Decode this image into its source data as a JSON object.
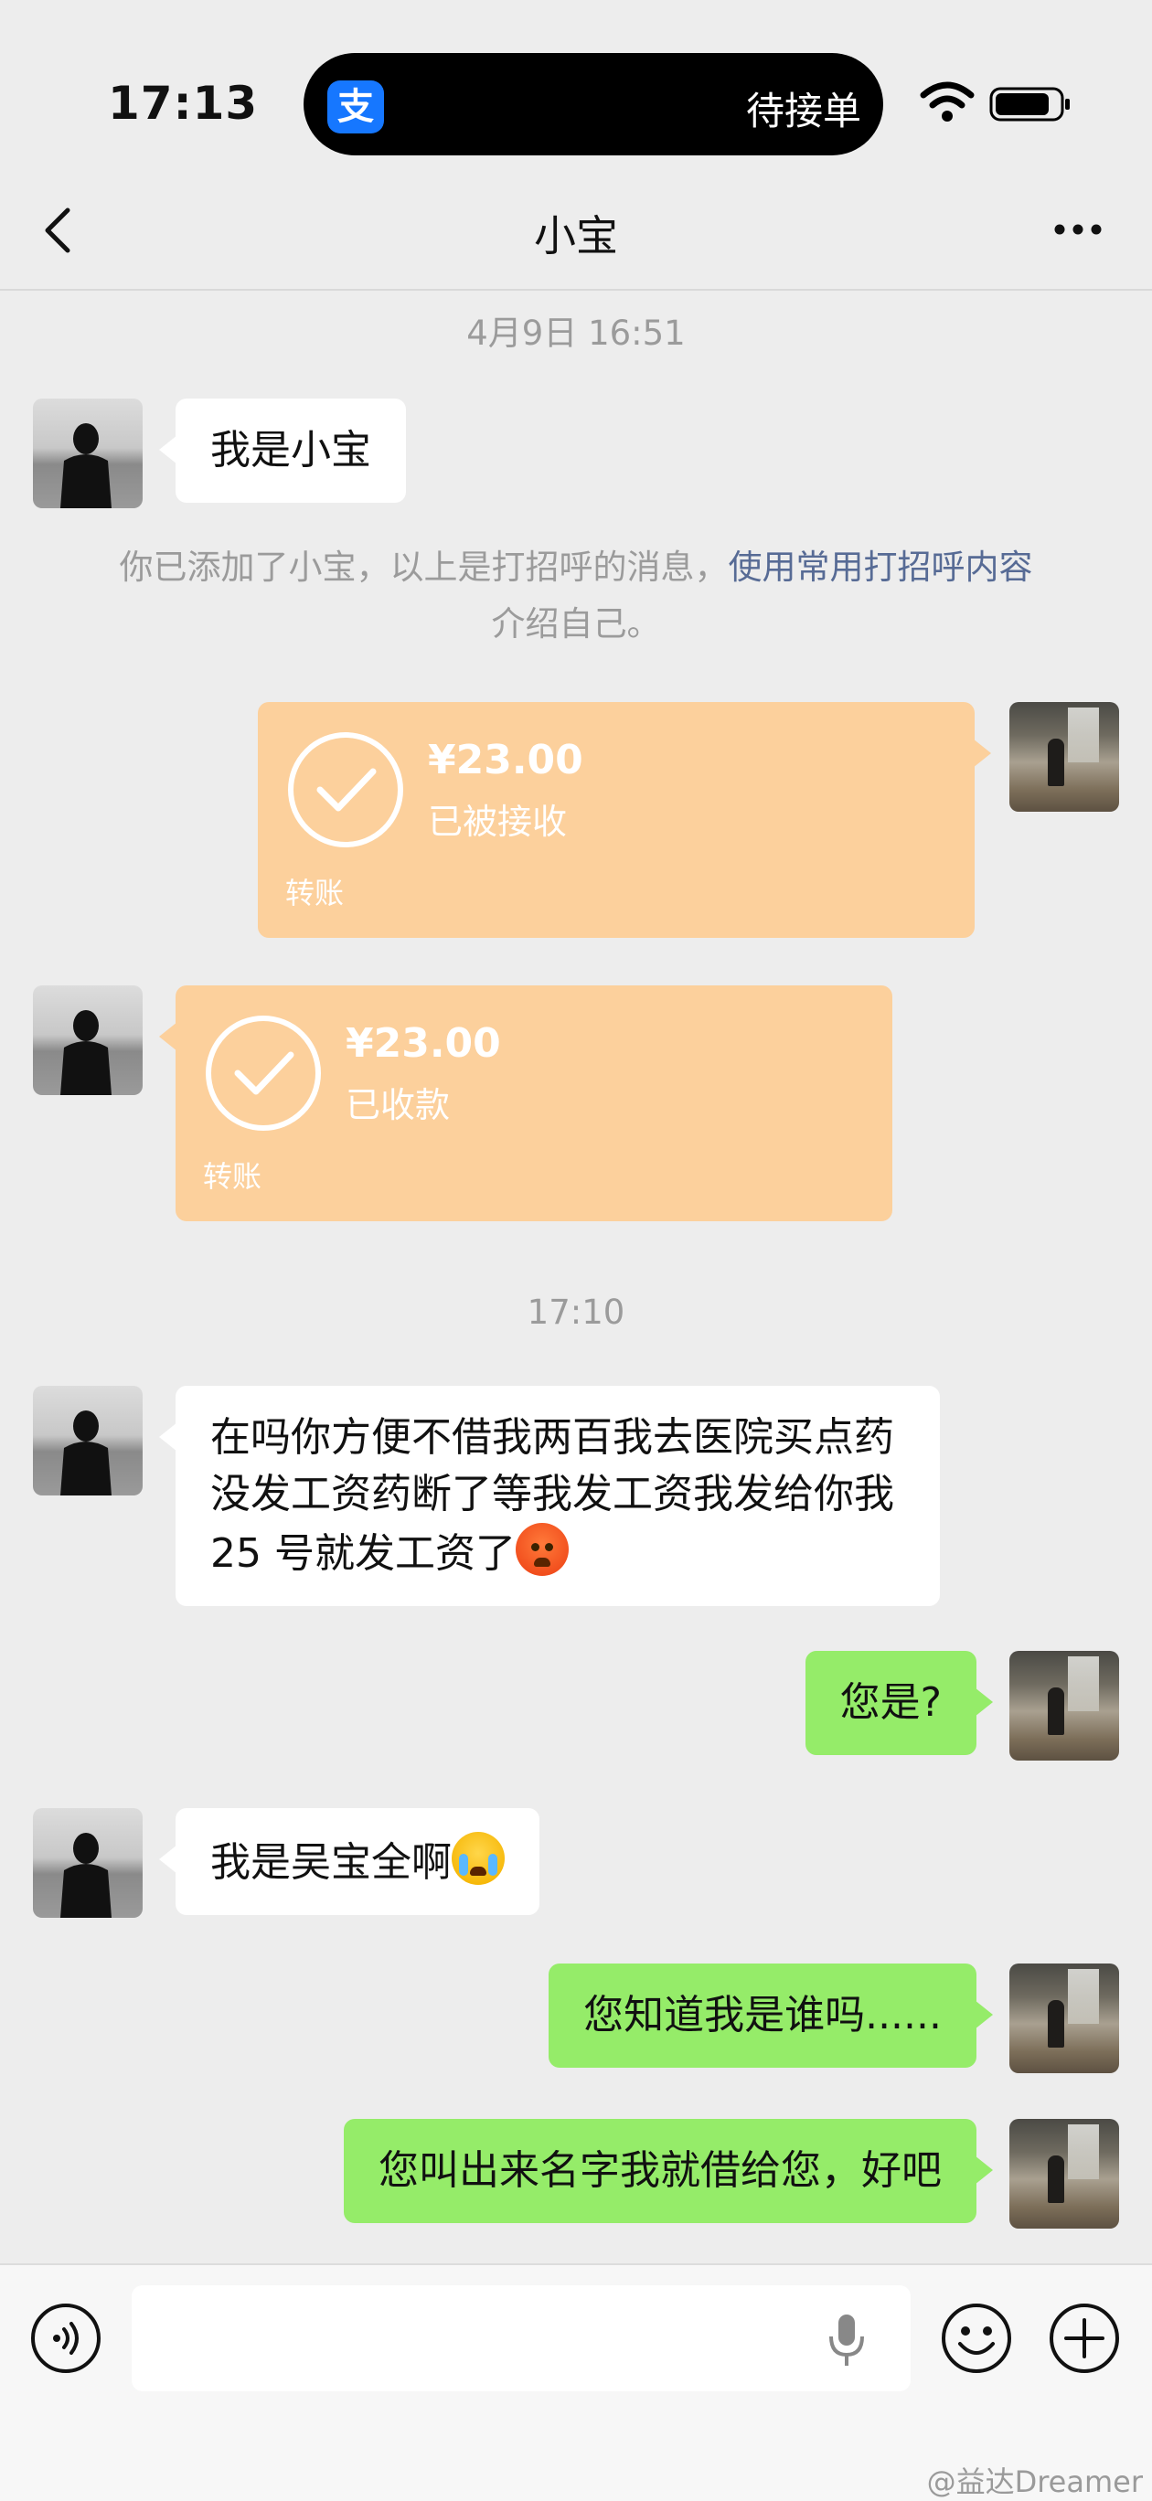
{
  "status_bar": {
    "time": "17:13",
    "island_app_icon": "支",
    "island_text": "待接单",
    "icons": [
      "wifi-icon",
      "battery-icon"
    ]
  },
  "nav": {
    "title": "小宝",
    "icons": [
      "back-icon",
      "more-icon"
    ]
  },
  "chat": {
    "timestamp_1": "4月9日 16:51",
    "msg_intro": "我是小宝",
    "system_note_prefix": "你已添加了小宝，以上是打招呼的消息，",
    "system_note_link": "使用常用打招呼内容",
    "system_note_suffix": "介绍自己。",
    "transfer_1": {
      "amount": "¥23.00",
      "status": "已被接收",
      "label": "转账"
    },
    "transfer_2": {
      "amount": "¥23.00",
      "status": "已收款",
      "label": "转账"
    },
    "timestamp_2": "17:10",
    "msg_borrow": "在吗你方便不借我两百我去医院买点药没发工资药断了等我发工资我发给你我 25 号就发工资了",
    "msg_who": "您是?",
    "msg_name": "我是吴宝全啊",
    "msg_know": "您知道我是谁吗......",
    "msg_call": "您叫出来名字我就借给您，好吧"
  },
  "input_bar": {
    "placeholder": "",
    "icons": [
      "voice-icon",
      "mic-icon",
      "emoji-icon",
      "plus-icon"
    ]
  },
  "watermark": "@益达Dreamer",
  "colors": {
    "background": "#ededed",
    "mine_bubble": "#95ec69",
    "their_bubble": "#ffffff",
    "transfer_card": "#fcd09c",
    "link": "#576b95"
  }
}
